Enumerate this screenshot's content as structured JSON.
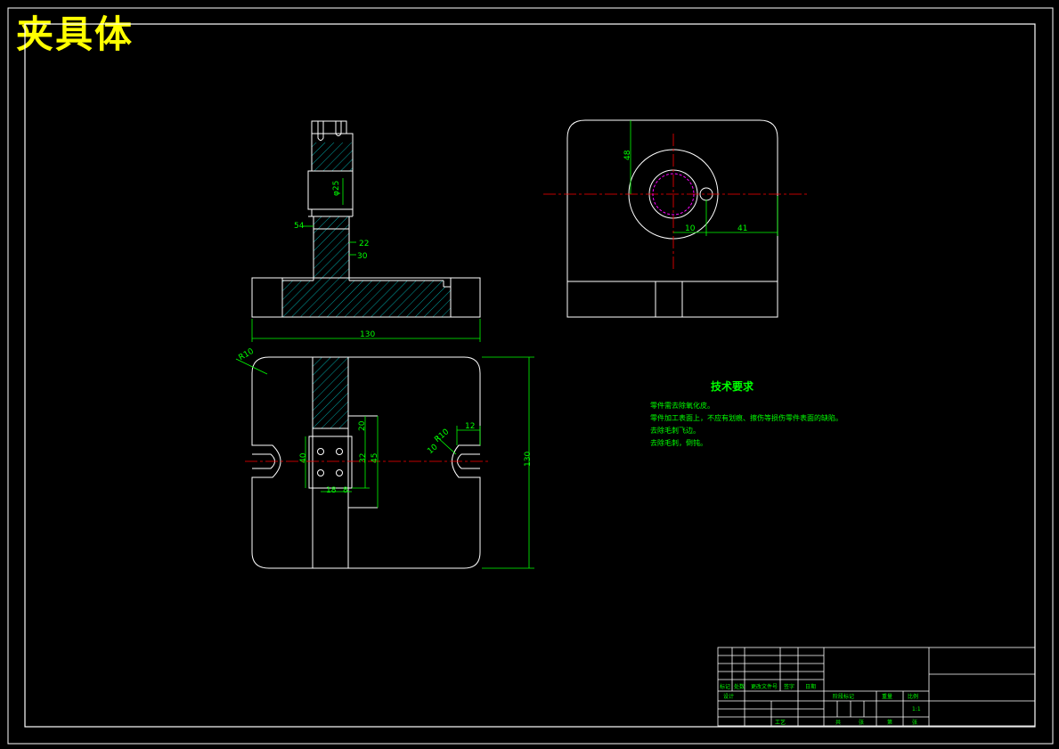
{
  "drawing": {
    "title": "夹具体",
    "colors": {
      "background": "#000000",
      "outline": "#ffffff",
      "dimension": "#00ff00",
      "hatch": "#00cccc",
      "centerline": "#ff0000",
      "hidden": "#ff00ff",
      "title_text": "#ffff00"
    }
  },
  "front_view": {
    "dims": {
      "d54": "54",
      "d22": "22",
      "d30": "30",
      "width": "130",
      "bore": "φ25"
    }
  },
  "side_view": {
    "dims": {
      "height": "48",
      "d10": "10",
      "d41": "41"
    }
  },
  "top_view": {
    "dims": {
      "r10": "R10",
      "r10b": "R10",
      "d12": "12",
      "height": "130",
      "d18": "18",
      "d8": "8",
      "d40": "40",
      "d45": "45",
      "d20": "20",
      "d32": "32",
      "d10": "10"
    }
  },
  "tech_requirements": {
    "heading": "技术要求",
    "items": [
      "零件需去除氧化皮。",
      "零件加工表面上，不应有划痕、擦伤等损伤零件表面的缺陷。",
      "去除毛刺飞边。",
      "去除毛刺，倒钝。"
    ]
  },
  "title_block": {
    "labels": {
      "mark": "标记",
      "count": "处数",
      "change_doc": "更改文件号",
      "signature": "签字",
      "date": "日期",
      "design": "设计",
      "process": "工艺",
      "stage_mark": "阶段标记",
      "weight": "重量",
      "scale": "比例",
      "total": "共",
      "sheet": "张",
      "page": "第",
      "sheet2": "张"
    },
    "scale_value": "1:1"
  }
}
